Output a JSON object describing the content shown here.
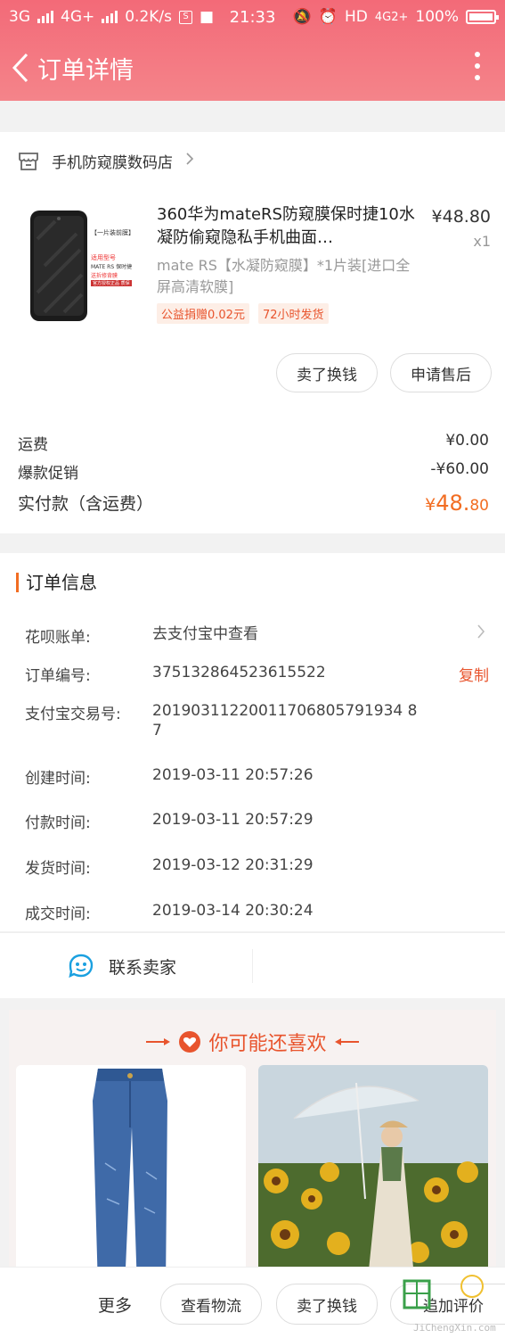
{
  "status_bar": {
    "left": "3G",
    "left2": "4G+",
    "speed": "0.2K/s",
    "time": "21:33",
    "hd": "HD",
    "net": "4G2+",
    "battery": "100%"
  },
  "nav": {
    "title": "订单详情"
  },
  "store": {
    "name": "手机防窥膜数码店"
  },
  "product": {
    "title": "360华为mateRS防窥膜保时捷10水凝防偷窥隐私手机曲面…",
    "spec": "mate RS【水凝防窥膜】*1片装[进口全屏高清软膜]",
    "tags": [
      "公益捐赠0.02元",
      "72小时发货"
    ],
    "price": "¥48.80",
    "qty": "x1",
    "image_text_top": "【一片装前膜】",
    "image_text_1": "适用型号",
    "image_text_2": "MATE RS 保时捷",
    "image_text_3": "送拆修背膜",
    "image_text_4": "官方授权正品 质保"
  },
  "buttons": {
    "sell": "卖了换钱",
    "aftersale": "申请售后"
  },
  "fees": {
    "shipping_label": "运费",
    "shipping_value": "¥0.00",
    "promo_label": "爆款促销",
    "promo_value": "-¥60.00",
    "total_label": "实付款（含运费）",
    "total_currency": "¥",
    "total_big": "48.",
    "total_small": "80"
  },
  "order_info": {
    "title": "订单信息",
    "rows": [
      {
        "label": "花呗账单:",
        "value": "去支付宝中查看"
      },
      {
        "label": "订单编号:",
        "value": "375132864523615522",
        "action": "复制"
      },
      {
        "label": "支付宝交易号:",
        "value": "20190311220011706805791934 87"
      },
      {
        "label": "创建时间:",
        "value": "2019-03-11 20:57:26"
      },
      {
        "label": "付款时间:",
        "value": "2019-03-11 20:57:29"
      },
      {
        "label": "发货时间:",
        "value": "2019-03-12 20:31:29"
      },
      {
        "label": "成交时间:",
        "value": "2019-03-14 20:30:24"
      }
    ]
  },
  "contact": {
    "label": "联系卖家"
  },
  "recommend": {
    "title": "你可能还喜欢"
  },
  "bottom_bar": {
    "more": "更多",
    "logistics": "查看物流",
    "sell": "卖了换钱",
    "review": "追加评价"
  },
  "watermark": {
    "text": "JiChengXin.com"
  },
  "colors": {
    "header": "#f36a78",
    "accent": "#e8542d",
    "tag_bg": "#fdeee6"
  }
}
